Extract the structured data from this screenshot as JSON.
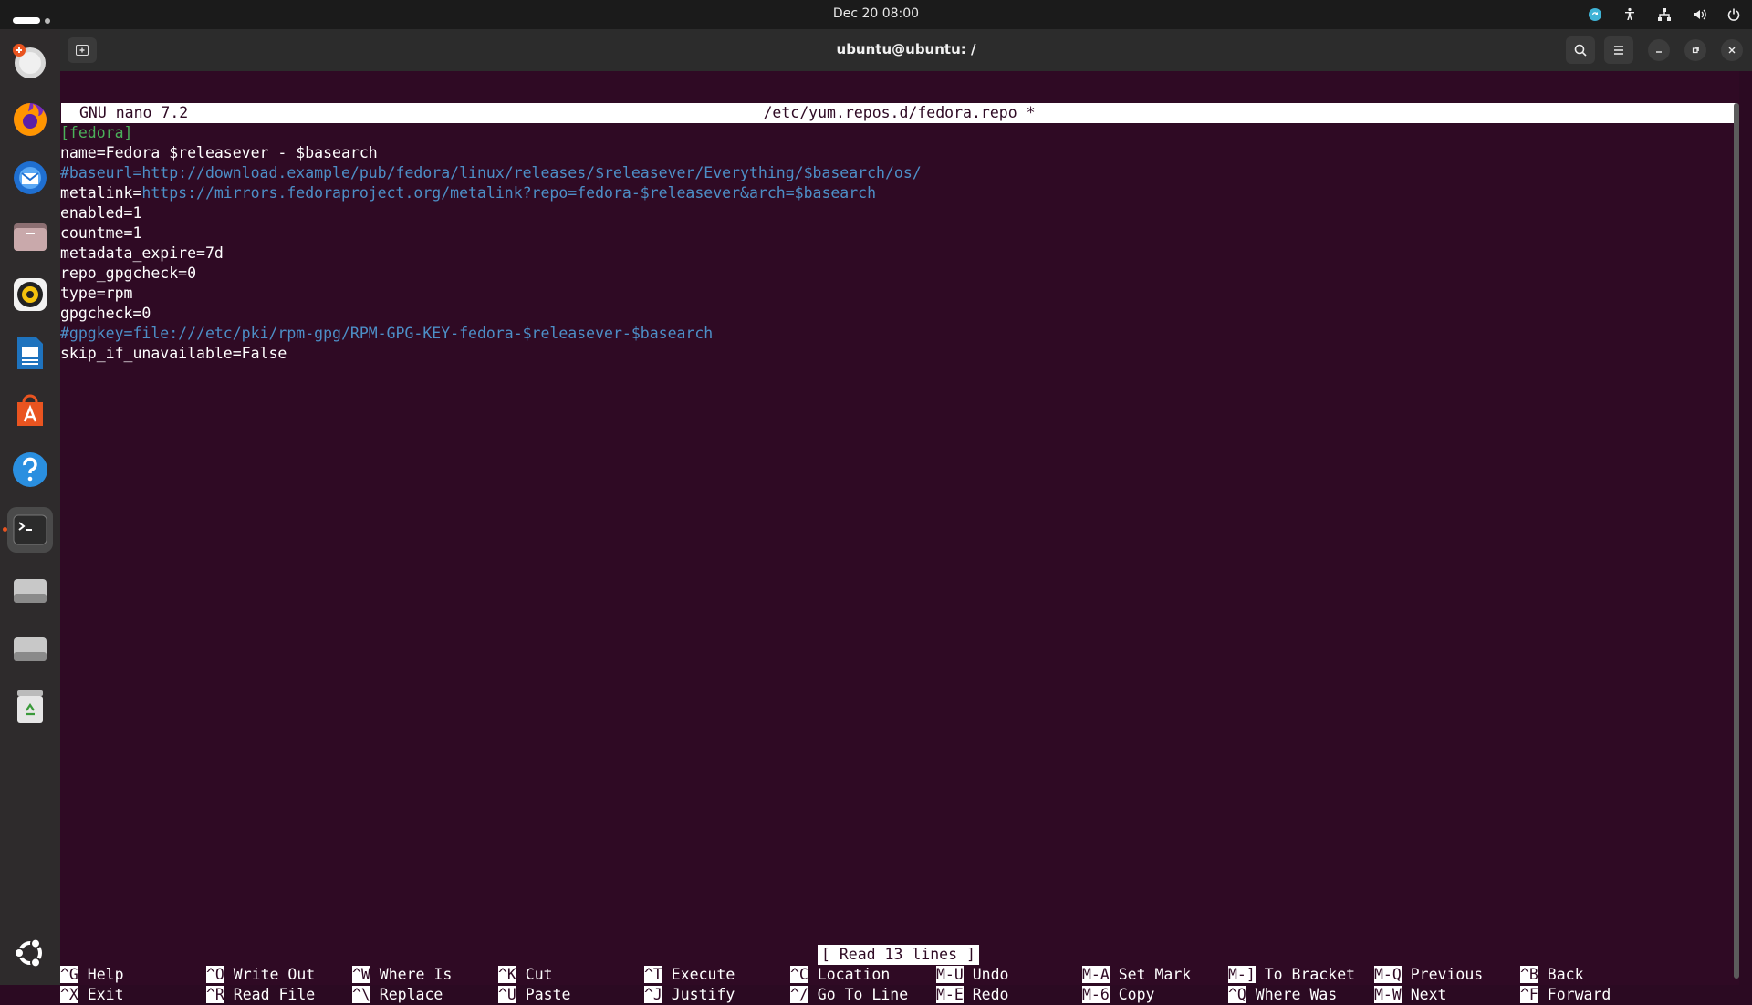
{
  "topbar": {
    "clock": "Dec 20  08:00"
  },
  "window": {
    "title": "ubuntu@ubuntu: /"
  },
  "nano": {
    "version": "GNU nano 7.2",
    "filename": "/etc/yum.repos.d/fedora.repo *",
    "lines": {
      "l1": "[fedora]",
      "l2": "name=Fedora $releasever - $basearch",
      "l3": "#baseurl=http://download.example/pub/fedora/linux/releases/$releasever/Everything/$basearch/os/",
      "l4_key": "metalink=",
      "l4_url": "https://mirrors.fedoraproject.org/metalink?repo=fedora-$releasever&arch=$basearch",
      "l5": "enabled=1",
      "l6": "countme=1",
      "l7": "metadata_expire=7d",
      "l8": "repo_gpgcheck=0",
      "l9": "type=rpm",
      "l10": "gpgcheck=0",
      "l11": "#gpgkey=file:///etc/pki/rpm-gpg/RPM-GPG-KEY-fedora-$releasever-$basearch",
      "l12": "skip_if_unavailable=False"
    },
    "status": "[ Read 13 lines ]",
    "shortcuts": [
      {
        "k1": "^G",
        "l1": " Help",
        "k2": "^X",
        "l2": " Exit"
      },
      {
        "k1": "^O",
        "l1": " Write Out",
        "k2": "^R",
        "l2": " Read File"
      },
      {
        "k1": "^W",
        "l1": " Where Is",
        "k2": "^\\",
        "l2": " Replace"
      },
      {
        "k1": "^K",
        "l1": " Cut",
        "k2": "^U",
        "l2": " Paste"
      },
      {
        "k1": "^T",
        "l1": " Execute",
        "k2": "^J",
        "l2": " Justify"
      },
      {
        "k1": "^C",
        "l1": " Location",
        "k2": "^/",
        "l2": " Go To Line"
      },
      {
        "k1": "M-U",
        "l1": " Undo",
        "k2": "M-E",
        "l2": " Redo"
      },
      {
        "k1": "M-A",
        "l1": " Set Mark",
        "k2": "M-6",
        "l2": " Copy"
      },
      {
        "k1": "M-]",
        "l1": " To Bracket",
        "k2": "^Q",
        "l2": " Where Was"
      },
      {
        "k1": "M-Q",
        "l1": " Previous",
        "k2": "M-W",
        "l2": " Next"
      },
      {
        "k1": "^B",
        "l1": " Back",
        "k2": "^F",
        "l2": " Forward"
      }
    ]
  },
  "colors": {
    "terminal_bg": "#2f0a24",
    "section": "#4bb05a",
    "comment": "#4d8fc7",
    "accent": "#e95420"
  }
}
